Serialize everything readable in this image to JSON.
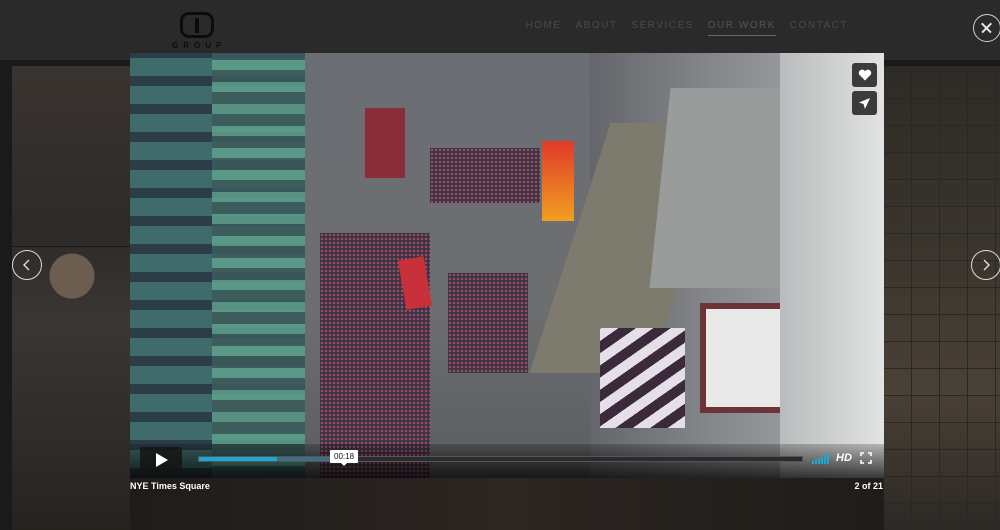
{
  "header": {
    "logo_text": "GROUP",
    "nav": [
      {
        "label": "HOME",
        "active": false
      },
      {
        "label": "ABOUT",
        "active": false
      },
      {
        "label": "SERVICES",
        "active": false
      },
      {
        "label": "OUR WORK",
        "active": true
      },
      {
        "label": "CONTACT",
        "active": false
      }
    ]
  },
  "lightbox": {
    "close_icon": "close-icon",
    "prev_icon": "chevron-left-icon",
    "next_icon": "chevron-right-icon",
    "caption": "NYE Times Square",
    "counter": "2 of 21"
  },
  "player": {
    "current_time": "00:18",
    "progress": 0.13,
    "buffered": 0.24,
    "hd_label": "HD",
    "accent_color": "#1aa8d8",
    "icons": [
      "heart-icon",
      "share-icon",
      "play-icon",
      "volume-icon",
      "fullscreen-icon"
    ]
  }
}
